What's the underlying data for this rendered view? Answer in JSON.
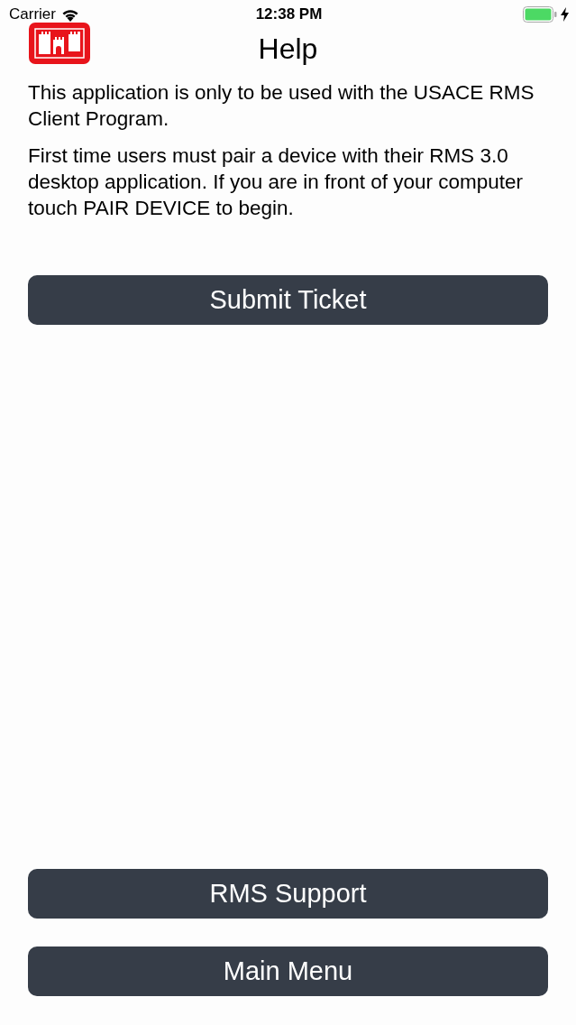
{
  "status_bar": {
    "carrier": "Carrier",
    "time": "12:38 PM"
  },
  "header": {
    "title": "Help"
  },
  "paragraphs": [
    "This application is only to be used with the USACE RMS Client Program.",
    "First time users must pair a device with their RMS 3.0 desktop application. If you are in front of your computer touch PAIR DEVICE to begin."
  ],
  "buttons": [
    {
      "label": "Submit Ticket"
    }
  ],
  "footer_buttons": [
    {
      "label": "RMS Support"
    },
    {
      "label": "Main Menu"
    }
  ]
}
